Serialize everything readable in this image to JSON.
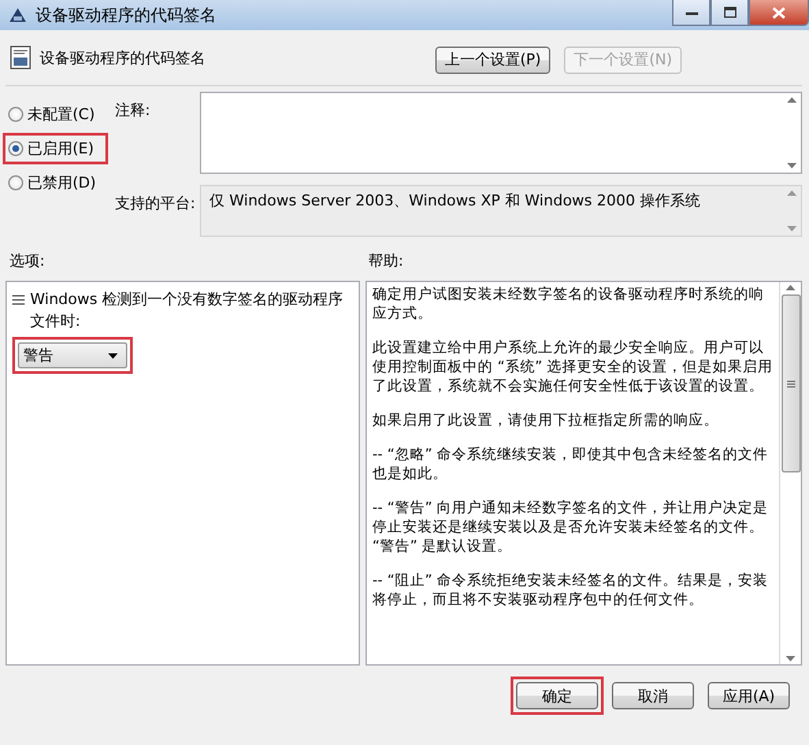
{
  "window": {
    "title": "设备驱动程序的代码签名"
  },
  "header": {
    "title": "设备驱动程序的代码签名",
    "buttons": [
      {
        "label": "上一个设置(P)",
        "disabled": false
      },
      {
        "label": "下一个设置(N)",
        "disabled": true
      }
    ]
  },
  "state_options": [
    {
      "label": "未配置(C)",
      "selected": false,
      "highlighted": false
    },
    {
      "label": "已启用(E)",
      "selected": true,
      "highlighted": true
    },
    {
      "label": "已禁用(D)",
      "selected": false,
      "highlighted": false
    }
  ],
  "comment": {
    "label": "注释:"
  },
  "platform": {
    "label": "支持的平台:",
    "value": "仅 Windows Server 2003、Windows XP 和 Windows 2000 操作系统"
  },
  "options": {
    "heading": "选项:",
    "prompt": "Windows 检测到一个没有数字签名的驱动程序文件时:",
    "dropdown": {
      "value": "警告",
      "highlighted": true
    }
  },
  "help": {
    "heading": "帮助:",
    "paragraphs": [
      "确定用户试图安装未经数字签名的设备驱动程序时系统的响应方式。",
      "此设置建立给中用户系统上允许的最少安全响应。用户可以使用控制面板中的 “系统” 选择更安全的设置，但是如果启用了此设置，系统就不会实施任何安全性低于该设置的设置。",
      "如果启用了此设置，请使用下拉框指定所需的响应。",
      "-- “忽略” 命令系统继续安装，即使其中包含未经签名的文件也是如此。",
      "-- “警告” 向用户通知未经数字签名的文件，并让用户决定是停止安装还是继续安装以及是否允许安装未经签名的文件。 “警告” 是默认设置。",
      "-- “阻止” 命令系统拒绝安装未经签名的文件。结果是，安装将停止，而且将不安装驱动程序包中的任何文件。"
    ]
  },
  "buttons": [
    {
      "label": "确定",
      "highlighted": true
    },
    {
      "label": "取消",
      "highlighted": false
    },
    {
      "label": "应用(A)",
      "highlighted": false
    }
  ]
}
